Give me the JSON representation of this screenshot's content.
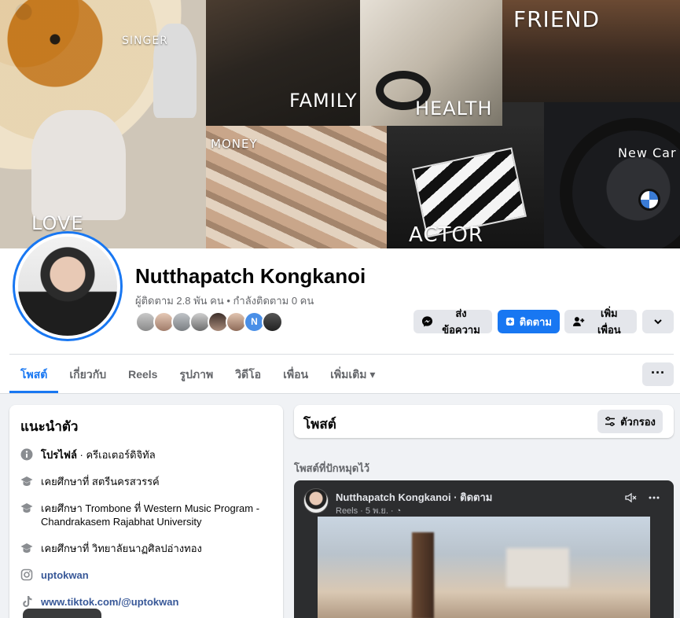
{
  "cover": {
    "labels": {
      "singer": "SINGER",
      "family": "FAMILY",
      "health": "HEALTH",
      "friend": "FRIEND",
      "love": "LOVE",
      "money": "MONEY",
      "new_car": "New Car",
      "actor": "ACTOR"
    }
  },
  "profile": {
    "name": "Nutthapatch Kongkanoi",
    "stats": "ผู้ติดตาม 2.8 พัน คน • กำลังติดตาม 0 คน",
    "friend_badge": "N"
  },
  "actions": {
    "message": "ส่งข้อความ",
    "follow": "ติดตาม",
    "add_friend": "เพิ่มเพื่อน"
  },
  "tabs": [
    {
      "label": "โพสต์"
    },
    {
      "label": "เกี่ยวกับ"
    },
    {
      "label": "Reels"
    },
    {
      "label": "รูปภาพ"
    },
    {
      "label": "วิดีโอ"
    },
    {
      "label": "เพื่อน"
    },
    {
      "label": "เพิ่มเติม ▾"
    }
  ],
  "tab_more": "···",
  "intro": {
    "title": "แนะนำตัว",
    "profile_prefix": "โปรไฟล์",
    "profile_type": " · ครีเอเตอร์ดิจิทัล",
    "education": [
      "เคยศึกษาที่ สตรีนครสวรรค์",
      "เคยศึกษา Trombone ที่ Western Music Program - Chandrakasem Rajabhat University",
      "เคยศึกษาที่ วิทยาลัยนาฏศิลปอ่างทอง"
    ],
    "instagram": "uptokwan",
    "tiktok": "www.tiktok.com/@uptokwan"
  },
  "posts": {
    "title": "โพสต์",
    "filter": "ตัวกรอง",
    "pinned_label": "โพสต์ที่ปักหมุดไว้"
  },
  "reel": {
    "author": "Nutthapatch Kongkanoi · ติดตาม",
    "meta": "Reels · 5 พ.ย. · ◔"
  }
}
